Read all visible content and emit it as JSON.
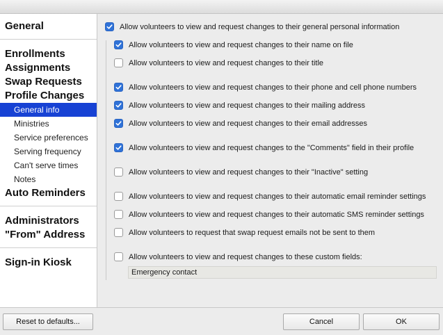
{
  "sidebar": {
    "general": "General",
    "enrollments": "Enrollments",
    "assignments": "Assignments",
    "swap_requests": "Swap Requests",
    "profile_changes": "Profile Changes",
    "sub_items": [
      "General info",
      "Ministries",
      "Service preferences",
      "Serving frequency",
      "Can't serve times",
      "Notes"
    ],
    "auto_reminders": "Auto Reminders",
    "administrators": "Administrators",
    "from_address": "\"From\" Address",
    "signin_kiosk": "Sign-in Kiosk"
  },
  "options": [
    {
      "label": "Allow volunteers to view and request changes to their general personal information",
      "checked": true
    },
    {
      "label": "Allow volunteers to view and request changes to their name on file",
      "checked": true
    },
    {
      "label": "Allow volunteers to view and request changes to their title",
      "checked": false
    },
    {
      "label": "Allow volunteers to view and request changes to their phone and cell phone numbers",
      "checked": true
    },
    {
      "label": "Allow volunteers to view and request changes to their mailing address",
      "checked": true
    },
    {
      "label": "Allow volunteers to view and request changes to their email addresses",
      "checked": true
    },
    {
      "label": "Allow volunteers to view and request changes to the \"Comments\" field in their profile",
      "checked": true
    },
    {
      "label": "Allow volunteers to view and request changes to their \"Inactive\" setting",
      "checked": false
    },
    {
      "label": "Allow volunteers to view and request changes to their automatic email reminder settings",
      "checked": false
    },
    {
      "label": "Allow volunteers to view and request changes to their automatic SMS reminder settings",
      "checked": false
    },
    {
      "label": "Allow volunteers to request that swap request emails not be sent to them",
      "checked": false
    },
    {
      "label": "Allow volunteers to view and request changes to these custom fields:",
      "checked": false
    }
  ],
  "custom_field_value": "Emergency contact",
  "buttons": {
    "reset": "Reset to defaults...",
    "cancel": "Cancel",
    "ok": "OK"
  },
  "colors": {
    "selection": "#1742d4",
    "checkbox_on": "#2f72d8"
  }
}
